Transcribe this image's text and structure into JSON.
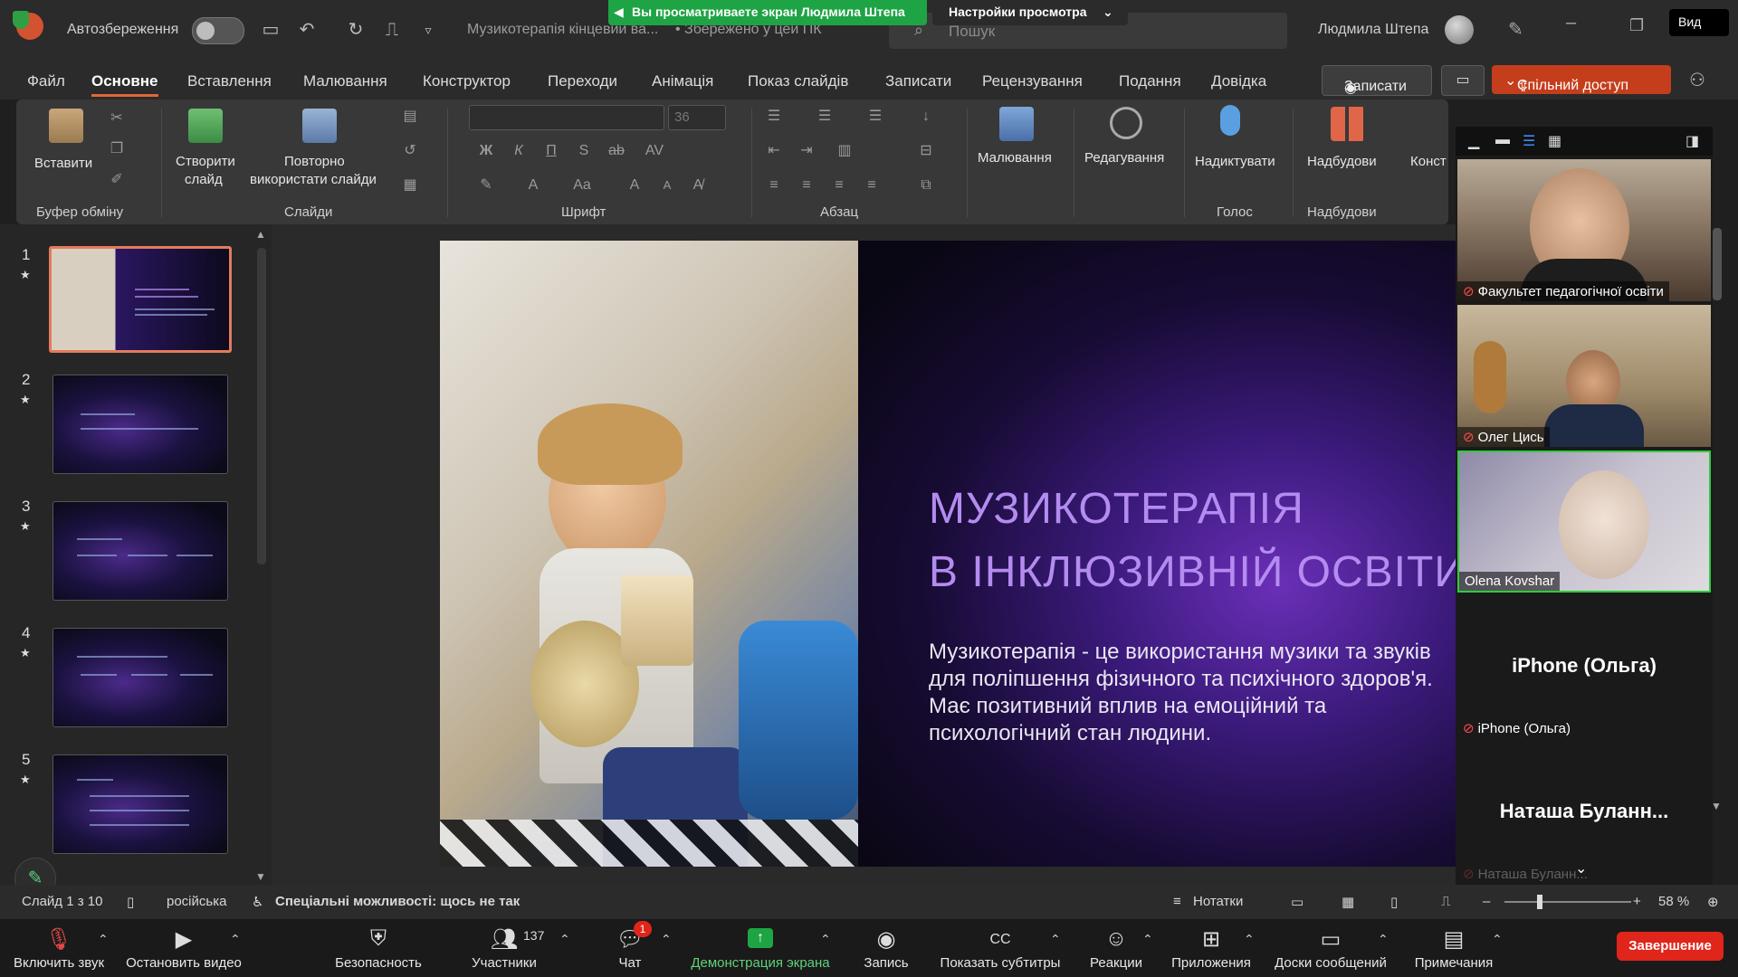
{
  "titlebar": {
    "autosave_label": "Автозбереження",
    "doc_title": "Музикотерапія кінцевий ва...",
    "save_status": "• Збережено у цей ПК",
    "search_placeholder": "Пошук",
    "user_name": "Людмила Штепа"
  },
  "zoom_banner": {
    "sharing_text": "Вы просматриваете экран Людмила Штепа",
    "view_options": "Настройки просмотра",
    "view_button": "Вид"
  },
  "menu": {
    "tabs": [
      "Файл",
      "Основне",
      "Вставлення",
      "Малювання",
      "Конструктор",
      "Переходи",
      "Анімація",
      "Показ слайдів",
      "Записати",
      "Рецензування",
      "Подання",
      "Довідка"
    ],
    "active": "Основне",
    "record_button": "Записати",
    "share_button": "Спільний доступ"
  },
  "ribbon": {
    "paste": "Вставити",
    "clipboard_group": "Буфер обміну",
    "new_slide_line1": "Створити",
    "new_slide_line2": "слайд",
    "reuse_line1": "Повторно",
    "reuse_line2": "використати слайди",
    "slides_group": "Слайди",
    "font_size": "36",
    "font_group": "Шрифт",
    "paragraph_group": "Абзац",
    "drawing": "Малювання",
    "editing": "Редагування",
    "dictate": "Надиктувати",
    "voice_group": "Голос",
    "addins": "Надбудови",
    "addins_group": "Надбудови",
    "designer_partial": "Конст"
  },
  "slides": [
    {
      "num": "1",
      "selected": true
    },
    {
      "num": "2",
      "selected": false
    },
    {
      "num": "3",
      "selected": false
    },
    {
      "num": "4",
      "selected": false
    },
    {
      "num": "5",
      "selected": false
    }
  ],
  "slide": {
    "title_line1": "МУЗИКОТЕРАПІЯ",
    "title_line2": "В ІНКЛЮЗИВНІЙ ОСВІТИ",
    "body": "Музикотерапія - це використання музики та звуків для поліпшення фізичного та психічного здоров'я. Має позитивний вплив на емоційний та психологічний стан людини."
  },
  "participants": [
    {
      "name": "Факультет педагогічної освіти",
      "muted": true
    },
    {
      "name": "Олег Цись",
      "muted": true
    },
    {
      "name": "Olena Kovshar",
      "muted": false
    },
    {
      "name": "iPhone (Ольга)",
      "display": "iPhone (Ольга)",
      "muted": true
    },
    {
      "name": "Наташа Буланн...",
      "display": "Наташа  Буланн...",
      "muted": true
    }
  ],
  "statusbar": {
    "slide_counter": "Слайд 1 з 10",
    "language": "російська",
    "accessibility": "Спеціальні можливості: щось не так",
    "notes": "Нотатки",
    "zoom": "58 %"
  },
  "zoom_toolbar": {
    "unmute": "Включить звук",
    "stop_video": "Остановить видео",
    "security": "Безопасность",
    "participants": "Участники",
    "participants_count": "137",
    "chat": "Чат",
    "chat_badge": "1",
    "share_screen": "Демонстрация экрана",
    "record": "Запись",
    "captions": "Показать субтитры",
    "reactions": "Реакции",
    "apps": "Приложения",
    "whiteboards": "Доски сообщений",
    "notes": "Примечания",
    "end": "Завершение"
  },
  "colors": {
    "accent_share": "#c43e1c",
    "zoom_green": "#1ea444",
    "end_red": "#e0251b",
    "title_purple": "#b48cf0"
  }
}
